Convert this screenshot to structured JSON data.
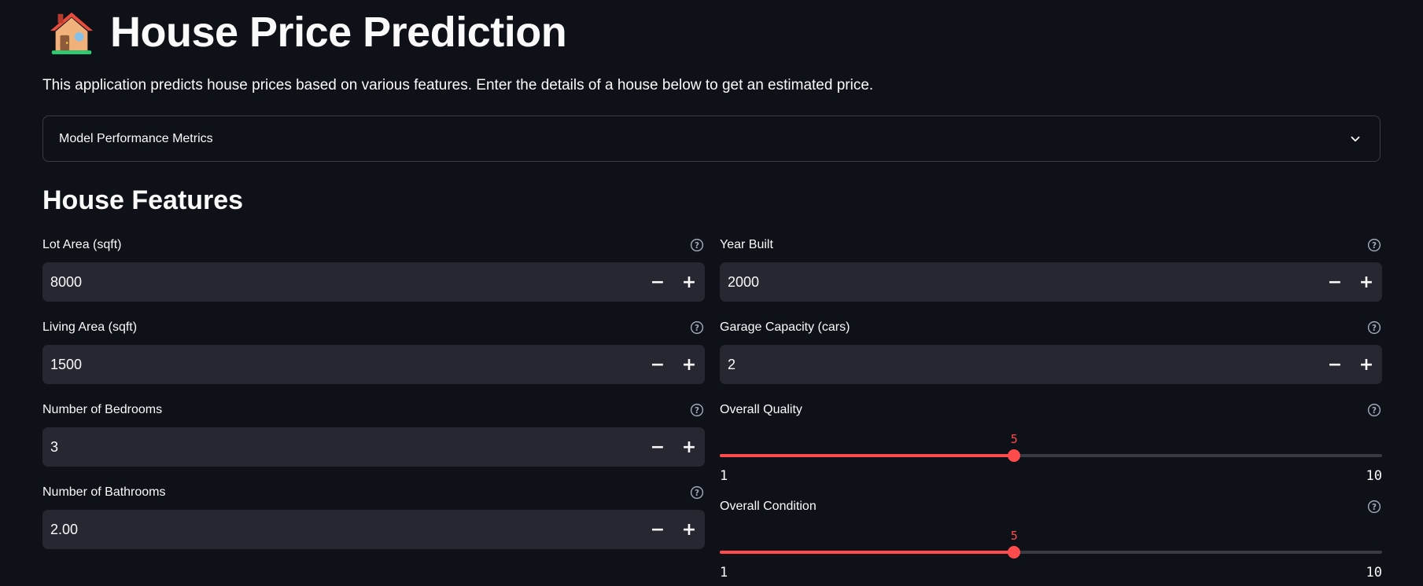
{
  "header": {
    "icon": "house-emoji-icon",
    "title": "House Price Prediction"
  },
  "intro": "This application predicts house prices based on various features. Enter the details of a house below to get an estimated price.",
  "expander": {
    "label": "Model Performance Metrics",
    "icon": "chevron-down-icon"
  },
  "section_title": "House Features",
  "left_fields": [
    {
      "label": "Lot Area (sqft)",
      "value": "8000"
    },
    {
      "label": "Living Area (sqft)",
      "value": "1500"
    },
    {
      "label": "Number of Bedrooms",
      "value": "3"
    },
    {
      "label": "Number of Bathrooms",
      "value": "2.00"
    }
  ],
  "right_fields": [
    {
      "label": "Year Built",
      "value": "2000"
    },
    {
      "label": "Garage Capacity (cars)",
      "value": "2"
    }
  ],
  "sliders": [
    {
      "label": "Overall Quality",
      "value": 5,
      "min": 1,
      "max": 10,
      "display_value": "5",
      "min_label": "1",
      "max_label": "10"
    },
    {
      "label": "Overall Condition",
      "value": 5,
      "min": 1,
      "max": 10,
      "display_value": "5",
      "min_label": "1",
      "max_label": "10"
    }
  ],
  "stepper": {
    "minus": "−",
    "plus": "+"
  },
  "colors": {
    "background": "#0e1117",
    "input_bg": "#262730",
    "accent": "#ff4b4b",
    "text": "#fafafa",
    "border": "#3a3d46"
  }
}
